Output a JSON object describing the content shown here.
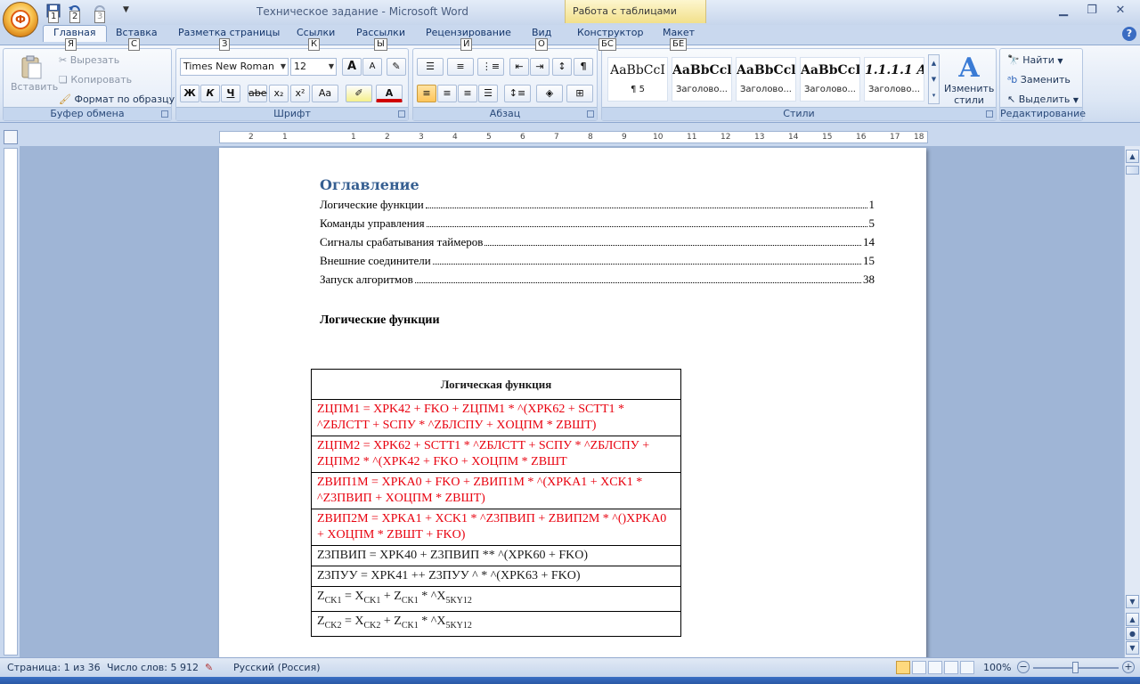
{
  "window": {
    "title": "Техническое задание - Microsoft Word",
    "context_tab_group": "Работа с таблицами",
    "office_button_glyph": "Ф",
    "qat_keytips": [
      "1",
      "2",
      "3"
    ]
  },
  "tabs": [
    {
      "label": "Главная",
      "keytip": "Я",
      "active": true
    },
    {
      "label": "Вставка",
      "keytip": "С"
    },
    {
      "label": "Разметка страницы",
      "keytip": "З"
    },
    {
      "label": "Ссылки",
      "keytip": "К"
    },
    {
      "label": "Рассылки",
      "keytip": "Ы"
    },
    {
      "label": "Рецензирование",
      "keytip": "И"
    },
    {
      "label": "Вид",
      "keytip": "О"
    },
    {
      "label": "Конструктор",
      "keytip": "БС"
    },
    {
      "label": "Макет",
      "keytip": "БЕ"
    }
  ],
  "ribbon": {
    "clipboard": {
      "label": "Буфер обмена",
      "paste": "Вставить",
      "cut": "Вырезать",
      "copy": "Копировать",
      "format_painter": "Формат по образцу"
    },
    "font": {
      "label": "Шрифт",
      "font_name": "Times New Roman",
      "font_size": "12",
      "buttons": {
        "bold": "Ж",
        "italic": "К",
        "underline": "Ч",
        "strike": "abe",
        "subscript": "x₂",
        "superscript": "x²",
        "case": "Aa",
        "grow": "A",
        "shrink": "A"
      }
    },
    "paragraph": {
      "label": "Абзац",
      "pilcrow": "¶"
    },
    "styles": {
      "label": "Стили",
      "change_styles": "Изменить стили",
      "tiles": [
        {
          "sample": "AaBbCcI",
          "name": "¶ 5"
        },
        {
          "sample": "AaBbCcl",
          "name": "Заголово..."
        },
        {
          "sample": "AaBbCcl",
          "name": "Заголово..."
        },
        {
          "sample": "AaBbCcI",
          "name": "Заголово..."
        },
        {
          "sample": "1.1.1.1  A",
          "name": "Заголово..."
        }
      ]
    },
    "editing": {
      "label": "Редактирование",
      "find": "Найти",
      "replace": "Заменить",
      "select": "Выделить"
    }
  },
  "ruler": {
    "labels_left": [
      "2",
      "1"
    ],
    "labels_right": [
      "1",
      "2",
      "3",
      "4",
      "5",
      "6",
      "7",
      "8",
      "9",
      "10",
      "11",
      "12",
      "13",
      "14",
      "15",
      "16",
      "17",
      "18"
    ]
  },
  "document": {
    "toc_heading": "Оглавление",
    "toc": [
      {
        "text": "Логические функции",
        "page": "1"
      },
      {
        "text": "Команды управления",
        "page": "5"
      },
      {
        "text": "Сигналы срабатывания таймеров",
        "page": "14"
      },
      {
        "text": "Внешние соединители",
        "page": "15"
      },
      {
        "text": "Запуск алгоритмов",
        "page": "38"
      }
    ],
    "section_heading": "Логические функции",
    "table_header": "Логическая функция",
    "rows": [
      {
        "text": "ZЦПМ1 = XPK42 + FKO + ZЦПМ1 * ^(XPK62 + SCTT1 * ^ZБЛСТТ + SCПУ * ^ZБЛСПУ + XОЦПМ * ZВШТ)",
        "red": true
      },
      {
        "text": "ZЦПМ2 = XPK62 + SCTT1 * ^ZБЛСТТ + SCПУ * ^ZБЛСПУ + ZЦПМ2 * ^(XPK42 + FKO + XОЦПМ * ZВШТ",
        "red": true
      },
      {
        "text": "ZВИП1М = XPKA0 + FKO + ZВИП1М * ^(XPKA1 + XCK1 * ^Z3ПВИП + XОЦПМ * ZВШТ)",
        "red": true
      },
      {
        "text": "ZВИП2М = XPKA1 + XCK1 * ^Z3ПВИП + ZВИП2М * ^()XPKA0 + XОЦПМ * ZВШТ + FKO)",
        "red": true
      },
      {
        "text": "Z3ПВИП = XPK40 + Z3ПВИП ** ^(XPK60 + FKO)",
        "red": false
      },
      {
        "text": "Z3ПУУ = XPK41 ++ Z3ПУУ ^ * ^(XPK63 + FKO)",
        "red": false
      }
    ],
    "row7": {
      "z": "Z",
      "z_sub": "CK1",
      "eq": " = X",
      "x_sub": "CK1",
      "plus": " + Z",
      "z2_sub": "CK1",
      "tail": " * ^X",
      "tail_sub": "5KY12"
    },
    "row8": {
      "z": "Z",
      "z_sub": "CK2",
      "eq": " = X",
      "x_sub": "CK2",
      "plus": " + Z",
      "z2_sub": "CK1",
      "tail": " * ^X",
      "tail_sub": "5KY12"
    }
  },
  "statusbar": {
    "page": "Страница: 1 из 36",
    "words": "Число слов: 5 912",
    "language": "Русский (Россия)",
    "zoom": "100%"
  },
  "colors": {
    "accent": "#365f91",
    "formula_red": "#e8000e",
    "ribbon_blue": "#c5d6ee"
  }
}
